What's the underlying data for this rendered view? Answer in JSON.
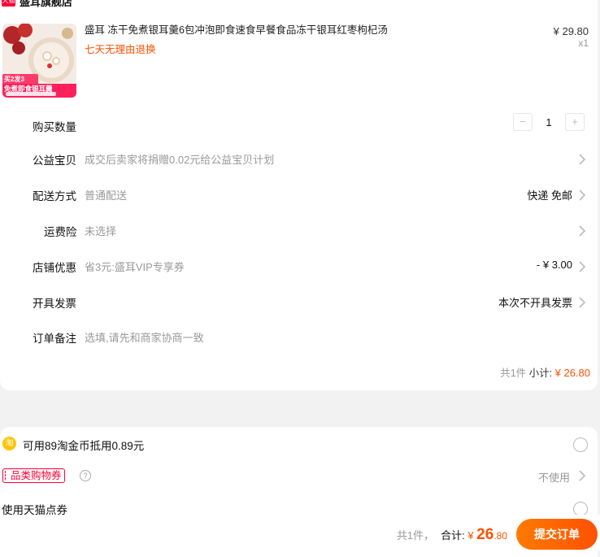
{
  "shop": {
    "badge": "天猫",
    "name": "盛耳旗舰店"
  },
  "product": {
    "title": "盛耳 冻干免煮银耳羹6包冲泡即食速食早餐食品冻干银耳红枣枸杞汤",
    "return_policy": "七天无理由退换",
    "price": "¥ 29.80",
    "quantity": "x1",
    "thumb_promo_1": "买2发3",
    "thumb_promo_2": "免煮即食银耳羹"
  },
  "rows": {
    "quantity": {
      "label": "购买数量",
      "minus": "−",
      "value": "1",
      "plus": "+"
    },
    "charity": {
      "label": "公益宝贝",
      "desc": "成交后卖家将捐赠0.02元给公益宝贝计划"
    },
    "delivery": {
      "label": "配送方式",
      "desc": "普通配送",
      "value": "快递 免邮"
    },
    "insurance": {
      "label": "运费险",
      "desc": "未选择"
    },
    "shop_discount": {
      "label": "店铺优惠",
      "desc": "省3元:盛耳VIP专享券",
      "value": "- ¥ 3.00"
    },
    "invoice": {
      "label": "开具发票",
      "value": "本次不开具发票"
    },
    "note": {
      "label": "订单备注",
      "desc": "选填,请先和商家协商一致"
    }
  },
  "subtotal": {
    "count": "共1件",
    "label": "小计:",
    "amount": "¥ 26.80"
  },
  "coins": {
    "icon": "淘",
    "text": "可用89淘金币抵用0.89元"
  },
  "category_coupon": {
    "tag": "品类购物券",
    "help": "?",
    "value": "不使用"
  },
  "tmall_points": {
    "text": "使用天猫点券"
  },
  "footer": {
    "count": "共1件，",
    "total_label": "合计:",
    "currency": "¥",
    "amount_int": "26",
    "amount_dec": ".80",
    "submit": "提交订单"
  },
  "colors": {
    "accent": "#ff5000",
    "tmall_red": "#ff0036",
    "coin_gold": "#ffc400"
  }
}
